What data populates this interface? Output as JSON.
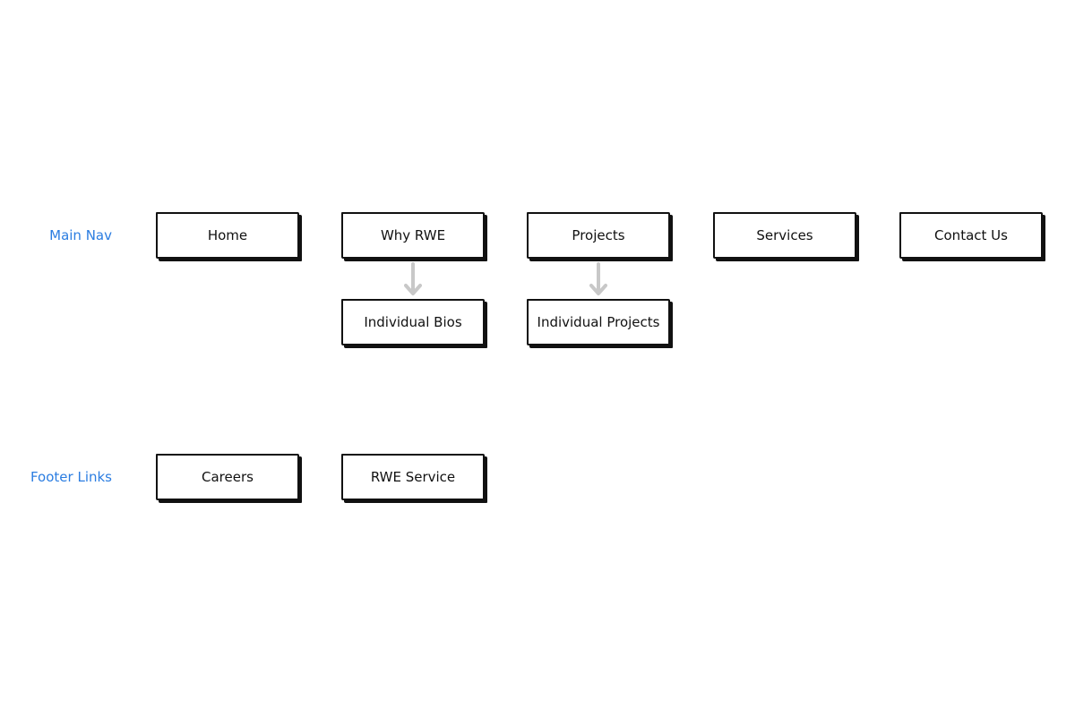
{
  "rows": {
    "main_nav_label": "Main Nav",
    "footer_links_label": "Footer Links"
  },
  "main_nav": [
    "Home",
    "Why RWE",
    "Projects",
    "Services",
    "Contact Us"
  ],
  "children": {
    "why_rwe": [
      "Individual Bios"
    ],
    "projects": [
      "Individual Projects"
    ]
  },
  "footer_links": [
    "Careers",
    "RWE Service"
  ],
  "colors": {
    "label": "#2b7de1",
    "arrow": "#c8c8c8",
    "border": "#111111"
  }
}
